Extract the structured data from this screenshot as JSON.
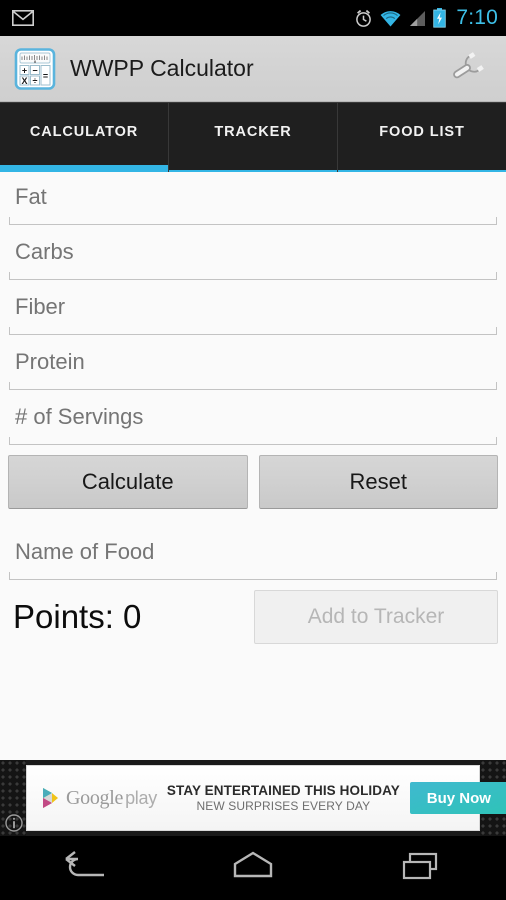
{
  "status_bar": {
    "notification_icon": "gmail-icon",
    "icons": [
      "alarm-icon",
      "wifi-icon",
      "cell-signal-icon",
      "battery-charging-icon"
    ],
    "time": "7:10",
    "clock_color": "#3dc0e8"
  },
  "action_bar": {
    "app_icon": "calculator-app-icon",
    "title": "WWPP Calculator",
    "settings_icon": "wrench-icon"
  },
  "tabs": {
    "active_index": 0,
    "accent_color": "#33b5e5",
    "items": [
      {
        "label": "CALCULATOR"
      },
      {
        "label": "TRACKER"
      },
      {
        "label": "FOOD LIST"
      }
    ]
  },
  "calculator": {
    "fields": [
      {
        "name": "fat",
        "placeholder": "Fat",
        "value": ""
      },
      {
        "name": "carbs",
        "placeholder": "Carbs",
        "value": ""
      },
      {
        "name": "fiber",
        "placeholder": "Fiber",
        "value": ""
      },
      {
        "name": "protein",
        "placeholder": "Protein",
        "value": ""
      },
      {
        "name": "servings",
        "placeholder": "# of Servings",
        "value": ""
      }
    ],
    "calculate_label": "Calculate",
    "reset_label": "Reset",
    "food_name": {
      "placeholder": "Name of Food",
      "value": ""
    },
    "points_text": "Points: 0",
    "add_to_tracker_label": "Add to Tracker",
    "add_to_tracker_enabled": false
  },
  "ad": {
    "brand": "Google",
    "brand_suffix": "play",
    "headline": "STAY ENTERTAINED THIS HOLIDAY",
    "subhead": "NEW SURPRISES EVERY DAY",
    "cta_label": "Buy Now",
    "info_icon": "info-icon",
    "cta_color": "#2fc3b8"
  },
  "nav_bar": {
    "back_icon": "back-arrow-icon",
    "home_icon": "home-icon",
    "recents_icon": "recent-apps-icon"
  }
}
